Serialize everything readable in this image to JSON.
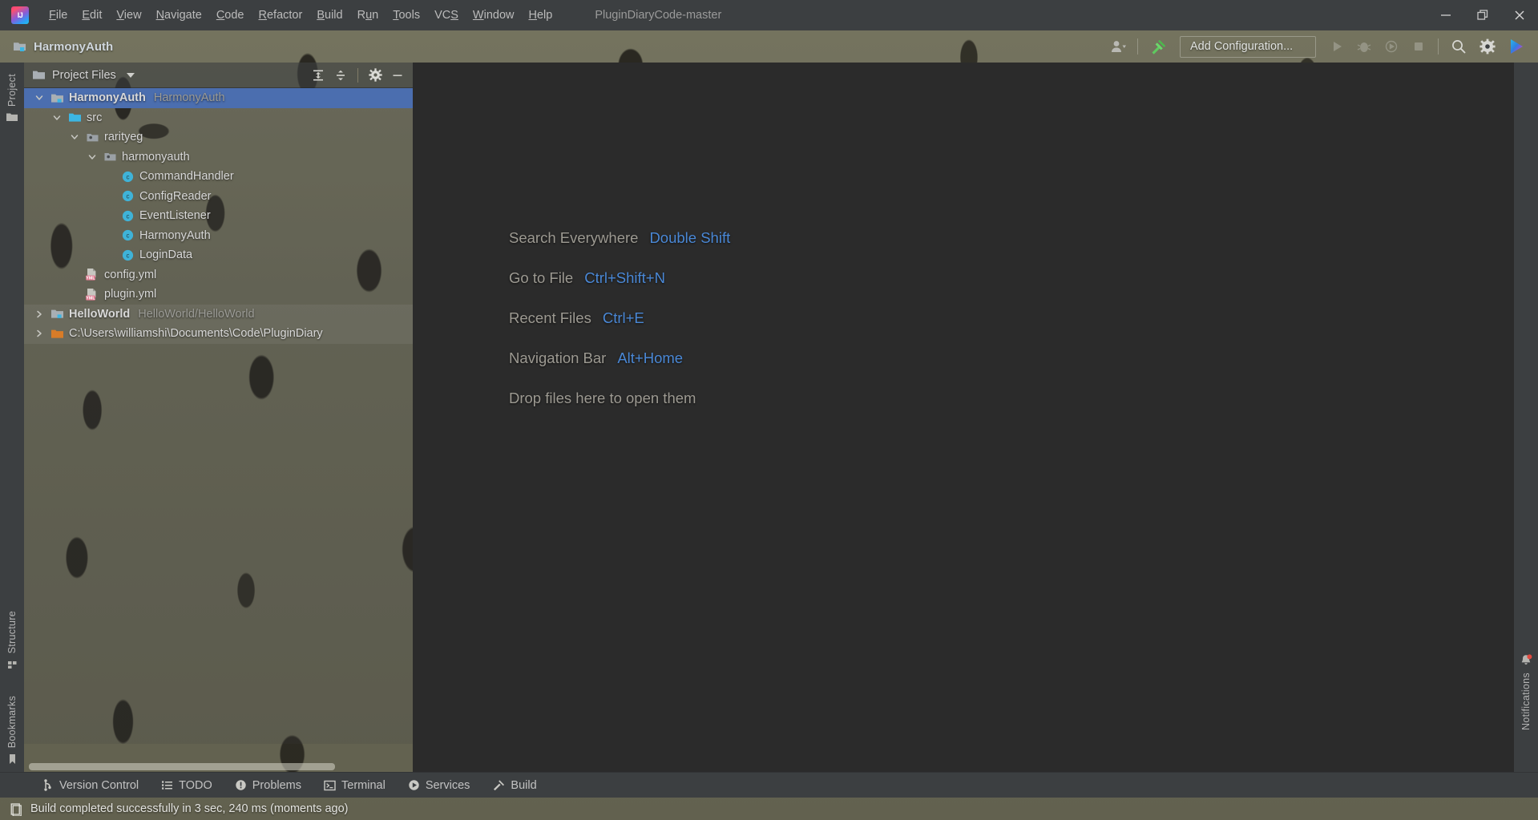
{
  "window": {
    "title": "PluginDiaryCode-master",
    "logo_text": "IJ",
    "controls": {
      "minimize": "minimize-icon",
      "restore": "restore-icon",
      "close": "close-icon"
    }
  },
  "menu": {
    "items": [
      {
        "label": "File",
        "mnemonic": "F"
      },
      {
        "label": "Edit",
        "mnemonic": "E"
      },
      {
        "label": "View",
        "mnemonic": "V"
      },
      {
        "label": "Navigate",
        "mnemonic": "N"
      },
      {
        "label": "Code",
        "mnemonic": "C"
      },
      {
        "label": "Refactor",
        "mnemonic": "R"
      },
      {
        "label": "Build",
        "mnemonic": "B"
      },
      {
        "label": "Run",
        "mnemonic": "u"
      },
      {
        "label": "Tools",
        "mnemonic": "T"
      },
      {
        "label": "VCS",
        "mnemonic": "S"
      },
      {
        "label": "Window",
        "mnemonic": "W"
      },
      {
        "label": "Help",
        "mnemonic": "H"
      }
    ]
  },
  "navbar": {
    "breadcrumb": "HarmonyAuth",
    "breadcrumb_icon": "module-folder-icon",
    "toolbar": {
      "account_icon": "user-account-icon",
      "account_dropdown_icon": "chevron-down-icon",
      "build_icon": "build-hammer-icon",
      "add_configuration_label": "Add Configuration...",
      "run_icon": "run-play-icon",
      "debug_icon": "debug-bug-icon",
      "run_with_coverage_icon": "run-coverage-icon",
      "stop_icon": "stop-square-icon",
      "search_icon": "search-icon",
      "settings_icon": "gear-icon",
      "updates_icon": "ide-update-icon"
    }
  },
  "left_strip": {
    "project_tab": {
      "label": "Project",
      "icon": "project-folder-icon"
    },
    "structure_tab": {
      "label": "Structure",
      "icon": "structure-grid-icon"
    },
    "bookmarks_tab": {
      "label": "Bookmarks",
      "icon": "bookmark-flag-icon"
    }
  },
  "right_strip": {
    "notifications_tab": {
      "label": "Notifications",
      "icon": "bell-icon",
      "has_badge": true
    }
  },
  "project_panel": {
    "title": "Project Files",
    "title_icon": "folder-icon",
    "title_dropdown_icon": "chevron-down-icon",
    "actions": {
      "expand_all": "expand-all-icon",
      "collapse_all": "collapse-all-icon",
      "settings": "gear-icon",
      "hide": "minimize-icon"
    },
    "tree": [
      {
        "indent": 0,
        "twisty": "expanded",
        "icon": "module-folder-icon",
        "label": "HarmonyAuth",
        "sub": "HarmonyAuth",
        "bold": true,
        "selected": true,
        "highlight": false
      },
      {
        "indent": 1,
        "twisty": "expanded",
        "icon": "source-folder-icon",
        "label": "src",
        "sub": "",
        "bold": false,
        "selected": false,
        "highlight": false
      },
      {
        "indent": 2,
        "twisty": "expanded",
        "icon": "package-icon",
        "label": "rarityeg",
        "sub": "",
        "bold": false,
        "selected": false,
        "highlight": false
      },
      {
        "indent": 3,
        "twisty": "expanded",
        "icon": "package-icon",
        "label": "harmonyauth",
        "sub": "",
        "bold": false,
        "selected": false,
        "highlight": false
      },
      {
        "indent": 4,
        "twisty": "none",
        "icon": "java-class-icon",
        "label": "CommandHandler",
        "sub": "",
        "bold": false,
        "selected": false,
        "highlight": false
      },
      {
        "indent": 4,
        "twisty": "none",
        "icon": "java-class-icon",
        "label": "ConfigReader",
        "sub": "",
        "bold": false,
        "selected": false,
        "highlight": false
      },
      {
        "indent": 4,
        "twisty": "none",
        "icon": "java-class-icon",
        "label": "EventListener",
        "sub": "",
        "bold": false,
        "selected": false,
        "highlight": false
      },
      {
        "indent": 4,
        "twisty": "none",
        "icon": "java-class-icon",
        "label": "HarmonyAuth",
        "sub": "",
        "bold": false,
        "selected": false,
        "highlight": false
      },
      {
        "indent": 4,
        "twisty": "none",
        "icon": "java-class-icon",
        "label": "LoginData",
        "sub": "",
        "bold": false,
        "selected": false,
        "highlight": false
      },
      {
        "indent": 2,
        "twisty": "none",
        "icon": "yml-file-icon",
        "label": "config.yml",
        "sub": "",
        "bold": false,
        "selected": false,
        "highlight": false
      },
      {
        "indent": 2,
        "twisty": "none",
        "icon": "yml-file-icon",
        "label": "plugin.yml",
        "sub": "",
        "bold": false,
        "selected": false,
        "highlight": false
      },
      {
        "indent": 0,
        "twisty": "collapsed",
        "icon": "module-folder-icon",
        "label": "HelloWorld",
        "sub": "HelloWorld/HelloWorld",
        "bold": true,
        "selected": false,
        "highlight": true
      },
      {
        "indent": 0,
        "twisty": "collapsed",
        "icon": "orange-folder-icon",
        "label": "C:\\Users\\williamshi\\Documents\\Code\\PluginDiary",
        "sub": "",
        "bold": false,
        "selected": false,
        "highlight": true
      }
    ]
  },
  "editor": {
    "shortcuts": [
      {
        "label": "Search Everywhere",
        "key": "Double Shift"
      },
      {
        "label": "Go to File",
        "key": "Ctrl+Shift+N"
      },
      {
        "label": "Recent Files",
        "key": "Ctrl+E"
      },
      {
        "label": "Navigation Bar",
        "key": "Alt+Home"
      }
    ],
    "drop_hint": "Drop files here to open them"
  },
  "bottom_bar": {
    "items": [
      {
        "label": "Version Control",
        "icon": "vcs-branch-icon"
      },
      {
        "label": "TODO",
        "icon": "todo-list-icon"
      },
      {
        "label": "Problems",
        "icon": "problems-warning-icon"
      },
      {
        "label": "Terminal",
        "icon": "terminal-icon"
      },
      {
        "label": "Services",
        "icon": "services-play-icon"
      },
      {
        "label": "Build",
        "icon": "build-hammer-icon"
      }
    ]
  },
  "status_bar": {
    "icon": "build-status-icon",
    "message": "Build completed successfully in 3 sec, 240 ms (moments ago)"
  },
  "colors": {
    "accent_selection": "#4b6eaf",
    "shortcut_key": "#4a88d6",
    "editor_bg": "#2b2b2b",
    "chrome_bg": "#3c3f41",
    "wallpaper": "#6b6a58"
  }
}
